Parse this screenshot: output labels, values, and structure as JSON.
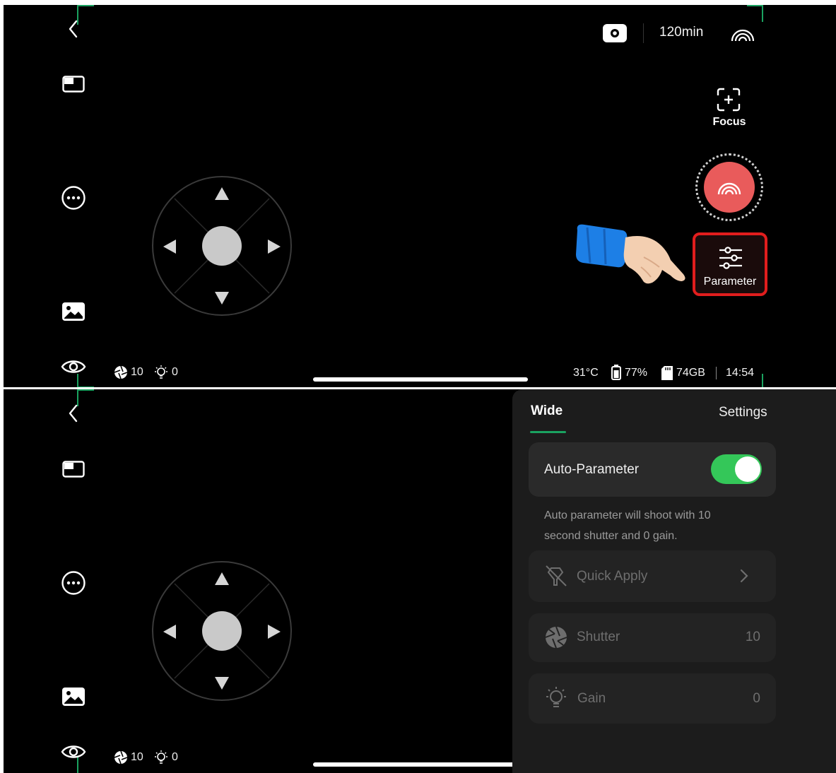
{
  "top": {
    "status": {
      "record_time": "120min",
      "temperature": "31°C",
      "battery": "77%",
      "storage": "74GB",
      "clock": "14:54"
    },
    "actions": {
      "focus_label": "Focus",
      "parameter_label": "Parameter"
    },
    "stats": {
      "shutter": "10",
      "gain": "0"
    }
  },
  "bottom": {
    "stats": {
      "shutter": "10",
      "gain": "0"
    },
    "panel": {
      "tabs": [
        {
          "label": "Wide"
        },
        {
          "label": "Settings"
        }
      ],
      "auto_parameter": {
        "label": "Auto-Parameter",
        "enabled": true,
        "description_line1": "Auto parameter will shoot with 10",
        "description_line2": "second shutter and 0 gain."
      },
      "quick_apply": {
        "label": "Quick Apply"
      },
      "shutter": {
        "label": "Shutter",
        "value": "10"
      },
      "gain": {
        "label": "Gain",
        "value": "0"
      }
    }
  },
  "colors": {
    "accent_green": "#1aa260",
    "toggle_green": "#34c759",
    "record_red": "#e95b5b",
    "highlight_red": "#e11d1d"
  }
}
